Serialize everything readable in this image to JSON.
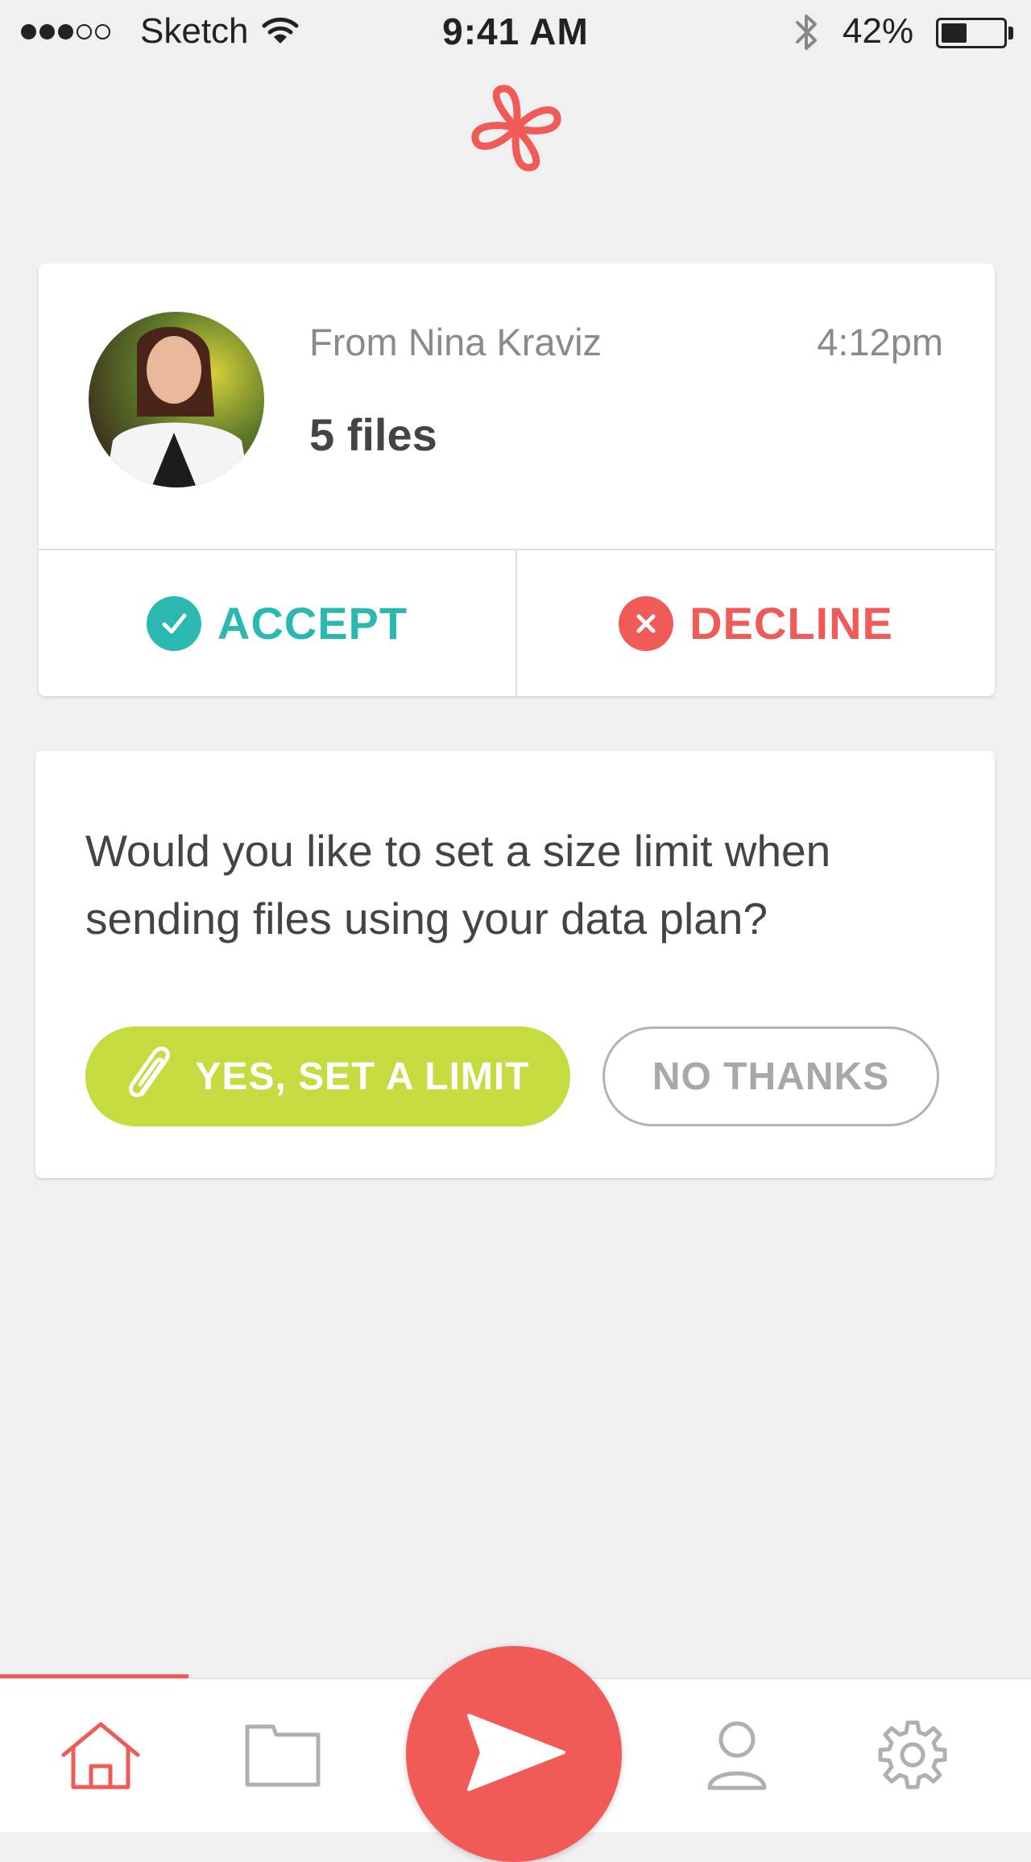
{
  "status_bar": {
    "carrier": "Sketch",
    "time": "9:41 AM",
    "battery_percent": "42%",
    "battery_level": 0.42,
    "signal_bars_filled": 3,
    "signal_bars_total": 5
  },
  "header": {
    "logo_icon": "flower-loop-logo"
  },
  "transfer_request": {
    "from": "From Nina Kraviz",
    "time": "4:12pm",
    "files": "5 files",
    "accept_label": "ACCEPT",
    "decline_label": "DECLINE"
  },
  "size_limit_prompt": {
    "question": "Would you like to set a size limit when sending files using your data plan?",
    "yes_label": "YES, SET A LIMIT",
    "no_label": "NO THANKS"
  },
  "tab_bar": {
    "tabs": [
      "home-icon",
      "folder-icon",
      "send-icon",
      "profile-icon",
      "settings-icon"
    ],
    "active_tab": "home"
  },
  "colors": {
    "brand": "#f05b58",
    "accept": "#2ab8b0",
    "decline": "#f05b58",
    "yes_button": "#c5db3f",
    "background": "#f0f0f0"
  }
}
